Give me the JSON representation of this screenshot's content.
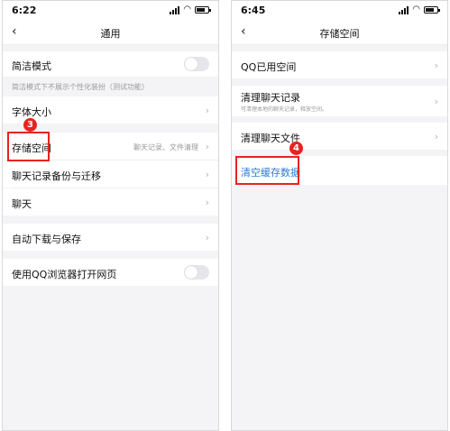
{
  "left": {
    "status_time": "6:22",
    "title": "通用",
    "concise_mode": {
      "label": "简洁模式",
      "toggle_on": false
    },
    "concise_note": "简洁模式下不展示个性化装扮（测试功能）",
    "font_size": {
      "label": "字体大小"
    },
    "storage": {
      "label": "存储空间",
      "detail": "聊天记录、文件清理"
    },
    "backup": {
      "label": "聊天记录备份与迁移"
    },
    "chat": {
      "label": "聊天"
    },
    "auto_download": {
      "label": "自动下载与保存"
    },
    "qq_browser": {
      "label": "使用QQ浏览器打开网页",
      "toggle_on": false
    },
    "step_badge": "3"
  },
  "right": {
    "status_time": "6:45",
    "title": "存储空间",
    "qq_used": {
      "label": "QQ已用空间"
    },
    "clear_chat": {
      "label": "清理聊天记录",
      "sub": "可清理本地的聊天记录，释放空间。"
    },
    "clear_files": {
      "label": "清理聊天文件"
    },
    "clear_cache": {
      "label": "清空缓存数据",
      "color": "#2d7bd6"
    },
    "step_badge": "4"
  },
  "colors": {
    "highlight": "#e8231f",
    "link": "#2d7bd6",
    "background": "#f4f4f7"
  }
}
